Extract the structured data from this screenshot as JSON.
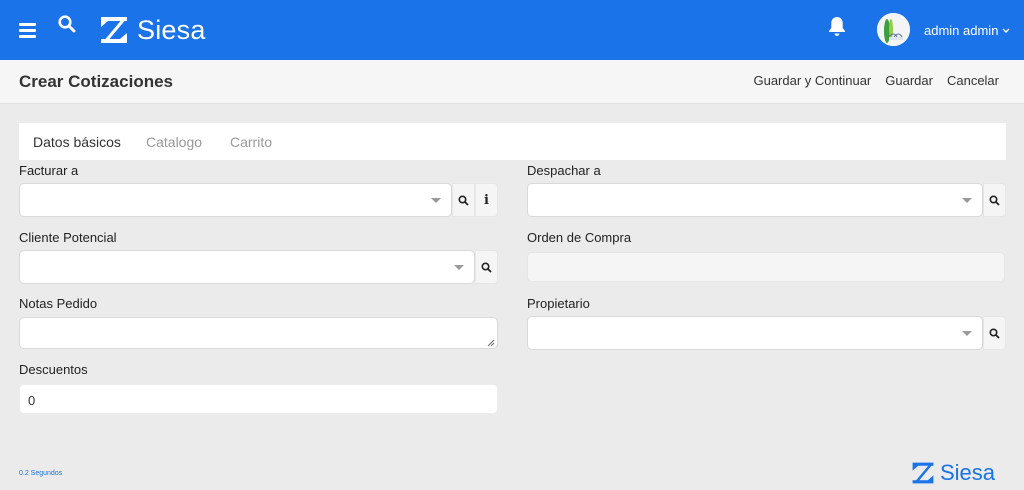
{
  "brand": {
    "name": "Siesa",
    "color": "#1a73e8"
  },
  "topbar": {
    "menu_icon": "hamburger-icon",
    "search_icon": "search-icon",
    "notifications_icon": "bell-icon",
    "user_name": "admin admin"
  },
  "header": {
    "title": "Crear Cotizaciones",
    "actions": [
      "Guardar y Continuar",
      "Guardar",
      "Cancelar"
    ]
  },
  "tabs": [
    {
      "label": "Datos básicos",
      "active": true
    },
    {
      "label": "Catalogo",
      "active": false
    },
    {
      "label": "Carrito",
      "active": false
    }
  ],
  "form": {
    "facturar_a": {
      "label": "Facturar a",
      "value": ""
    },
    "cliente_potencial": {
      "label": "Cliente Potencial",
      "value": ""
    },
    "notas_pedido": {
      "label": "Notas Pedido",
      "value": ""
    },
    "descuentos": {
      "label": "Descuentos",
      "value": "0"
    },
    "despachar_a": {
      "label": "Despachar a",
      "value": ""
    },
    "orden_de_compra": {
      "label": "Orden de Compra",
      "value": ""
    },
    "propietario": {
      "label": "Propietario",
      "value": ""
    }
  },
  "footer": {
    "timing": "0.2 Segundos"
  }
}
